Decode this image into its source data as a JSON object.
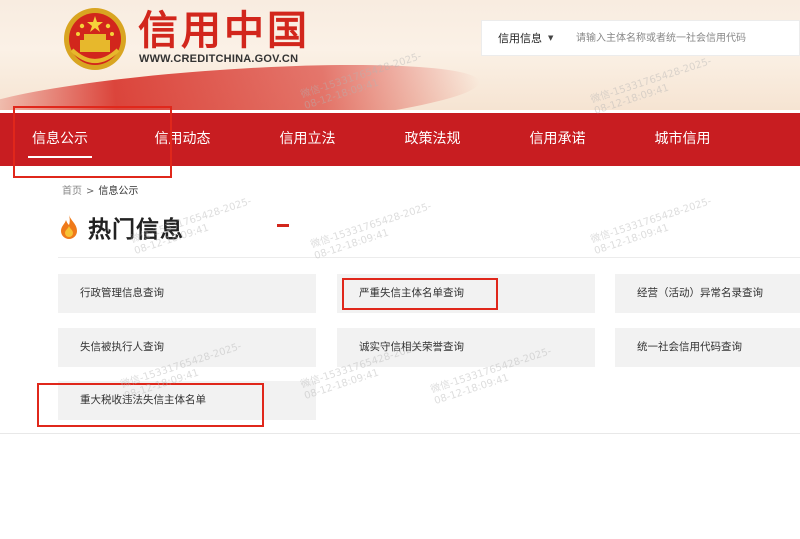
{
  "header": {
    "title": "信用中国",
    "url": "WWW.CREDITCHINA.GOV.CN"
  },
  "search": {
    "select_label": "信用信息",
    "placeholder": "请输入主体名称或者统一社会信用代码"
  },
  "nav": {
    "items": [
      "信息公示",
      "信用动态",
      "信用立法",
      "政策法规",
      "信用承诺",
      "城市信用"
    ]
  },
  "breadcrumb": {
    "home": "首页",
    "separator": ">",
    "current": "信息公示"
  },
  "section": {
    "title": "热门信息"
  },
  "links": [
    "行政管理信息查询",
    "严重失信主体名单查询",
    "经营（活动）异常名录查询",
    "失信被执行人查询",
    "诚实守信相关荣誉查询",
    "统一社会信用代码查询",
    "重大税收违法失信主体名单"
  ],
  "watermark": "微信-15331765428-2025-\n08-12-18:09:41",
  "colors": {
    "brand_red": "#c81d21",
    "annotation_red": "#e0271b",
    "title_red": "#d2261c"
  }
}
